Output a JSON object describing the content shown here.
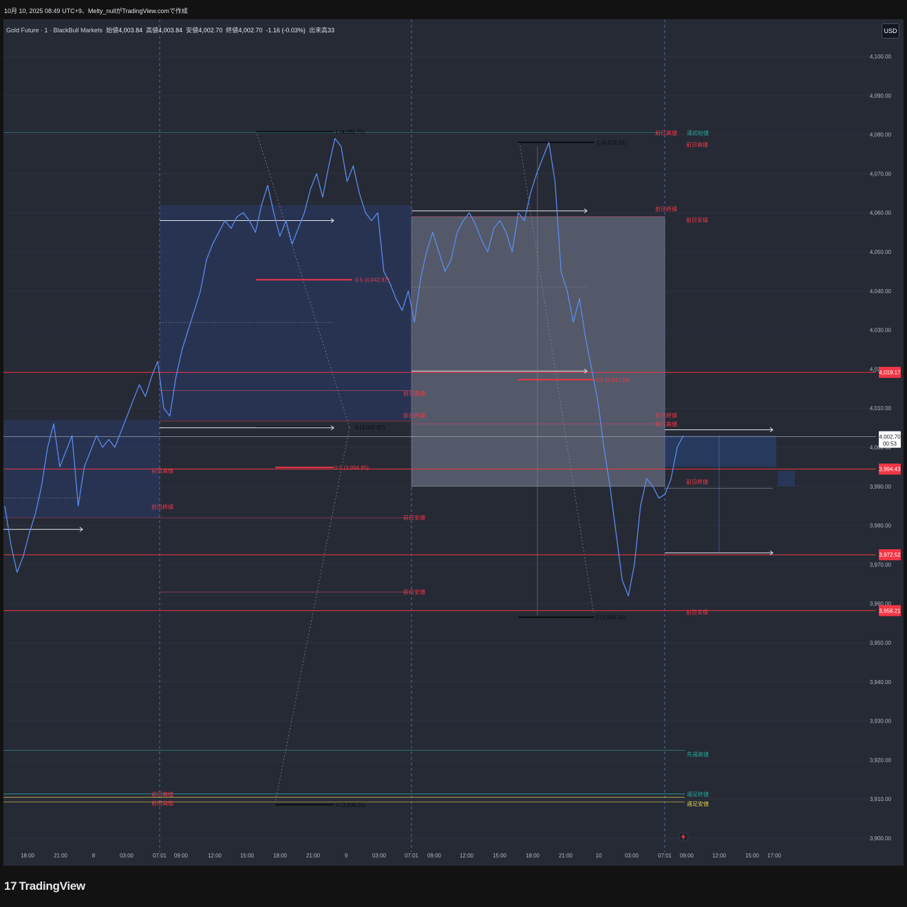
{
  "header": {
    "text": "10月 10, 2025 08:49 UTC+9、Melty_nullがTradingView.comで作成"
  },
  "legend": {
    "symbol": "Gold Future · 1 · BlackBull Markets",
    "open_label": "始値",
    "open": "4,003.84",
    "high_label": "高値",
    "high": "4,003.84",
    "low_label": "安値",
    "low": "4,002.70",
    "close_label": "終値",
    "close": "4,002.70",
    "change": "-1.16 (-0.03%)",
    "volume_label": "出来高",
    "volume": "33"
  },
  "currency": "USD",
  "brand": {
    "logo": "17",
    "name": "TradingView"
  },
  "colors": {
    "background": "#262a35",
    "price_line": "#5b8def",
    "red_level": "#f23645",
    "teal_level": "#26a69a",
    "yellow_level": "#e0d050",
    "box_blue": "#2a3a6a",
    "box_grey": "#5d6272"
  },
  "chart_data": {
    "type": "line",
    "title": "",
    "y_range": [
      3897,
      4106
    ],
    "y_ticks": [
      "4,100.00",
      "4,090.00",
      "4,080.00",
      "4,070.00",
      "4,060.00",
      "4,050.00",
      "4,040.00",
      "4,030.00",
      "4,020.00",
      "4,010.00",
      "4,000.00",
      "3,990.00",
      "3,980.00",
      "3,970.00",
      "3,960.00",
      "3,950.00",
      "3,940.00",
      "3,930.00",
      "3,920.00",
      "3,910.00",
      "3,900.00"
    ],
    "x_ticks": [
      "18:00",
      "21:00",
      "8",
      "03:00",
      "07:01",
      "09:00",
      "12:00",
      "15:00",
      "18:00",
      "21:00",
      "9",
      "03:00",
      "07:01",
      "09:00",
      "12:00",
      "15:00",
      "18:00",
      "21:00",
      "10",
      "03:00",
      "07:01",
      "09:00",
      "12:00",
      "15:00",
      "17:00"
    ],
    "series": [
      {
        "values": [
          3985,
          3975,
          3968,
          3972,
          3978,
          3983,
          3990,
          4000,
          4006,
          3995,
          3999,
          4003,
          3985,
          3995,
          3999,
          4003,
          4000,
          4002,
          4000,
          4004,
          4008,
          4012,
          4016,
          4013,
          4018,
          4022,
          4010,
          4008,
          4018,
          4025,
          4030,
          4035,
          4040,
          4048,
          4052,
          4055,
          4058,
          4056,
          4059,
          4060,
          4058,
          4055,
          4062,
          4067,
          4060,
          4054,
          4058,
          4052,
          4056,
          4060,
          4066,
          4070,
          4064,
          4072,
          4079,
          4077,
          4068,
          4072,
          4065,
          4060,
          4058,
          4060,
          4045,
          4042,
          4038,
          4035,
          4040,
          4032,
          4043,
          4050,
          4055,
          4050,
          4045,
          4048,
          4055,
          4058,
          4060,
          4057,
          4053,
          4050,
          4056,
          4058,
          4055,
          4050,
          4060,
          4058,
          4065,
          4070,
          4074,
          4078,
          4068,
          4045,
          4040,
          4032,
          4038,
          4028,
          4020,
          4012,
          4000,
          3990,
          3978,
          3966,
          3962,
          3970,
          3985,
          3992,
          3990,
          3987,
          3988,
          3992,
          4000,
          4003
        ]
      }
    ],
    "current_price": "4,002.70",
    "countdown": "00:53",
    "price_labels": [
      "4,019.17",
      "3,994.43",
      "3,972.52",
      "3,958.21"
    ],
    "fib_labels": [
      "1 (4,080.75)",
      "0.5 (4,042.87)",
      "0 (4,005.07)",
      "0.5 (3,994.85)",
      "1 (4,078.01)",
      "0.5 (4,017.29)",
      "0 (3,956.54)",
      "0 (3,908.55)"
    ],
    "level_labels": {
      "prev_high": "前日高値",
      "prev_close": "前日終値",
      "prev_low": "前日安値",
      "week_open": "週初始値",
      "last_week_high": "先週高値",
      "week_close": "週足終値",
      "week_low": "週足安値"
    }
  }
}
